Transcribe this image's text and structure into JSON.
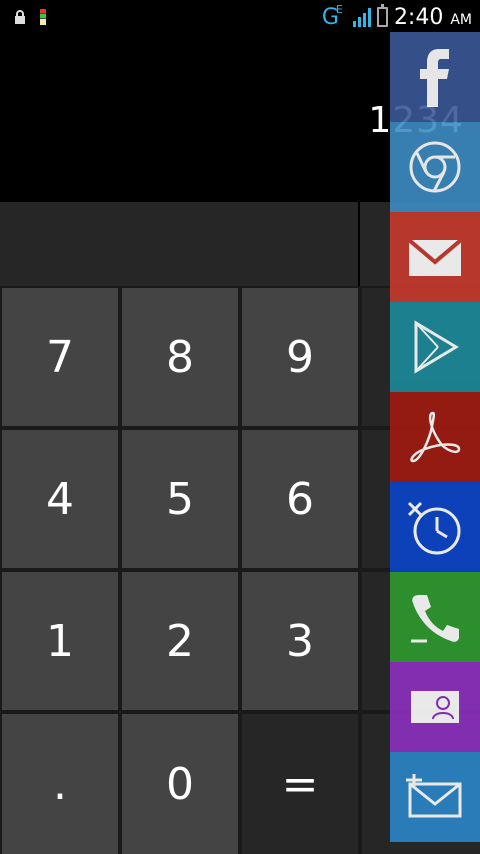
{
  "status_bar": {
    "network_type": "G",
    "network_sub": "E",
    "time": "2:40",
    "ampm": "AM",
    "icons": [
      "lock-icon",
      "battery-notification-icon"
    ]
  },
  "display": {
    "value": "1234"
  },
  "keypad": {
    "keys": [
      "7",
      "8",
      "9",
      "4",
      "5",
      "6",
      "1",
      "2",
      "3",
      ".",
      "0",
      "="
    ]
  },
  "launcher": {
    "apps": [
      {
        "name": "facebook",
        "icon": "facebook-icon",
        "color": "#3b5998"
      },
      {
        "name": "chrome",
        "icon": "chrome-icon",
        "color": "#2f8ac6"
      },
      {
        "name": "gmail",
        "icon": "mail-icon",
        "color": "#c8392d"
      },
      {
        "name": "play-store",
        "icon": "play-store-icon",
        "color": "#1b8a9a"
      },
      {
        "name": "acrobat",
        "icon": "acrobat-icon",
        "color": "#a11a10"
      },
      {
        "name": "clock",
        "icon": "clock-icon",
        "color": "#0a44c9"
      },
      {
        "name": "phone",
        "icon": "phone-icon",
        "color": "#2e9a2e"
      },
      {
        "name": "contacts",
        "icon": "contact-icon",
        "color": "#8b2fc0"
      },
      {
        "name": "messaging",
        "icon": "message-icon",
        "color": "#2a86c7"
      }
    ]
  }
}
